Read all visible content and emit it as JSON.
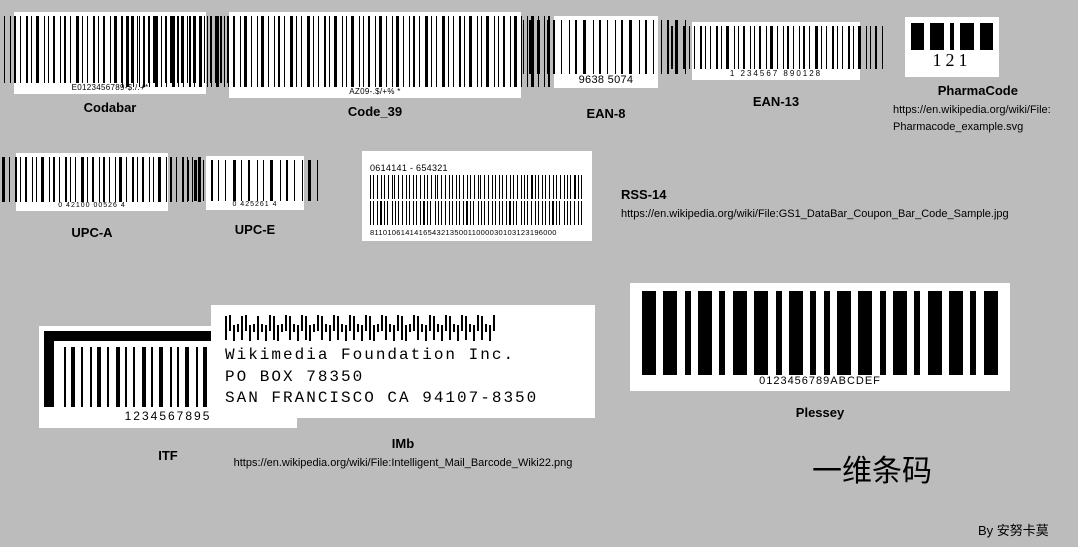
{
  "title": "一维条码",
  "author": "By 安努卡莫",
  "barcodes": {
    "codabar": {
      "label": "Codabar",
      "text": "E0123456789-$:/.+*"
    },
    "code39": {
      "label": "Code_39",
      "text": "AZ09-.$/+% *"
    },
    "ean8": {
      "label": "EAN-8",
      "text": "9638   5074"
    },
    "ean13": {
      "label": "EAN-13",
      "text": "1   234567    890128"
    },
    "pharmacode": {
      "label": "PharmaCode",
      "text": "121",
      "url": "https://en.wikipedia.org/wiki/File:\nPharmacode_example.svg"
    },
    "upca": {
      "label": "UPC-A",
      "text": "0   42100   00526   4"
    },
    "upce": {
      "label": "UPC-E",
      "text": "0   425261   4"
    },
    "imb_top": {
      "numbers": "0614141 - 654321",
      "digits": "811010614141654321350011000030103123196000"
    },
    "rss14": {
      "label": "RSS-14",
      "url": "https://en.wikipedia.org/wiki/File:GS1_DataBar_Coupon_Bar_Code_Sample.jpg"
    },
    "itf": {
      "label": "ITF",
      "text": "1234567895"
    },
    "imb": {
      "label": "IMb",
      "line1": "Wikimedia Foundation Inc.",
      "line2": "PO BOX 78350",
      "line3": "SAN FRANCISCO CA  94107-8350",
      "url": "https://en.wikipedia.org/wiki/File:Intelligent_Mail_Barcode_Wiki22.png"
    },
    "plessey": {
      "label": "Plessey",
      "text": "0123456789ABCDEF"
    }
  }
}
